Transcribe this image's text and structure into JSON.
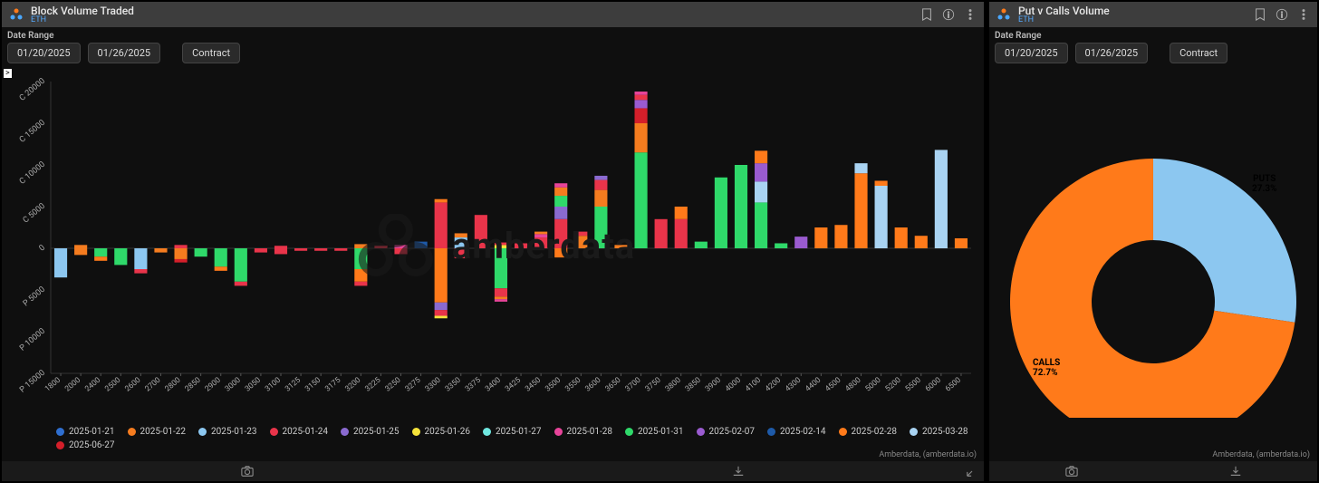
{
  "left": {
    "title": "Block Volume Traded",
    "subtitle": "ETH",
    "date_range_label": "Date Range",
    "date_from": "01/20/2025",
    "date_to": "01/26/2025",
    "contract_btn": "Contract",
    "badge": ">",
    "watermark": "amberdata",
    "attribution": "Amberdata, (amberdata.io)"
  },
  "right": {
    "title": "Put v Calls Volume",
    "subtitle": "ETH",
    "date_range_label": "Date Range",
    "date_from": "01/20/2025",
    "date_to": "01/26/2025",
    "contract_btn": "Contract",
    "attribution": "Amberdata, (amberdata.io)",
    "calls_label": "CALLS",
    "calls_pct": "72.7%",
    "puts_label": "PUTS",
    "puts_pct": "27.3%"
  },
  "colors": {
    "2025-01-21": "#2f6fd0",
    "2025-01-22": "#f57c1f",
    "2025-01-23": "#8cc7f0",
    "2025-01-24": "#e9344a",
    "2025-01-25": "#8a6ad0",
    "2025-01-26": "#f5e33a",
    "2025-01-27": "#6fe7e0",
    "2025-01-28": "#e8449a",
    "2025-01-31": "#2fd96a",
    "2025-02-07": "#9a5bd0",
    "2025-02-14": "#1e5aa8",
    "2025-02-28": "#ff7a1a",
    "2025-03-28": "#a9d3f2",
    "2025-06-27": "#d41f2a"
  },
  "chart_data": [
    {
      "type": "bar",
      "title": "Block Volume Traded",
      "ylabel_calls": "C",
      "ylabel_puts": "P",
      "ylim": [
        -15000,
        20000
      ],
      "y_ticks": [
        20000,
        15000,
        10000,
        5000,
        0,
        -5000,
        -10000,
        -15000
      ],
      "y_tick_labels": [
        "C 20000",
        "C 15000",
        "C 10000",
        "C 5000",
        "0",
        "P 5000",
        "P 10000",
        "P 15000"
      ],
      "categories": [
        "1800",
        "2000",
        "2400",
        "2500",
        "2600",
        "2700",
        "2800",
        "2850",
        "2900",
        "3000",
        "3050",
        "3100",
        "3125",
        "3150",
        "3175",
        "3200",
        "3225",
        "3250",
        "3275",
        "3300",
        "3350",
        "3375",
        "3400",
        "3425",
        "3450",
        "3500",
        "3550",
        "3600",
        "3650",
        "3700",
        "3750",
        "3800",
        "3850",
        "3900",
        "4000",
        "4100",
        "4200",
        "4300",
        "4400",
        "4500",
        "4800",
        "5000",
        "5200",
        "5500",
        "6000",
        "6500"
      ],
      "stacks": {
        "1800": {
          "calls": [],
          "puts": [
            [
              "2025-01-23",
              3500
            ]
          ]
        },
        "2000": {
          "calls": [
            [
              "2025-01-22",
              400
            ]
          ],
          "puts": [
            [
              "2025-01-22",
              800
            ]
          ]
        },
        "2400": {
          "calls": [],
          "puts": [
            [
              "2025-01-31",
              1000
            ],
            [
              "2025-02-28",
              500
            ]
          ]
        },
        "2500": {
          "calls": [],
          "puts": [
            [
              "2025-01-31",
              2000
            ]
          ]
        },
        "2600": {
          "calls": [],
          "puts": [
            [
              "2025-01-23",
              2500
            ],
            [
              "2025-01-24",
              500
            ]
          ]
        },
        "2700": {
          "calls": [],
          "puts": [
            [
              "2025-01-22",
              500
            ]
          ]
        },
        "2800": {
          "calls": [
            [
              "2025-01-24",
              400
            ]
          ],
          "puts": [
            [
              "2025-01-22",
              1300
            ],
            [
              "2025-06-27",
              400
            ]
          ]
        },
        "2850": {
          "calls": [],
          "puts": [
            [
              "2025-01-31",
              1000
            ]
          ]
        },
        "2900": {
          "calls": [],
          "puts": [
            [
              "2025-01-31",
              2200
            ],
            [
              "2025-02-28",
              500
            ]
          ]
        },
        "3000": {
          "calls": [],
          "puts": [
            [
              "2025-01-31",
              4000
            ],
            [
              "2025-01-24",
              500
            ]
          ]
        },
        "3050": {
          "calls": [],
          "puts": [
            [
              "2025-01-24",
              500
            ]
          ]
        },
        "3100": {
          "calls": [
            [
              "2025-01-24",
              300
            ]
          ],
          "puts": [
            [
              "2025-01-24",
              700
            ]
          ]
        },
        "3125": {
          "calls": [],
          "puts": [
            [
              "2025-01-24",
              300
            ]
          ]
        },
        "3150": {
          "calls": [],
          "puts": [
            [
              "2025-01-24",
              300
            ]
          ]
        },
        "3175": {
          "calls": [],
          "puts": [
            [
              "2025-01-24",
              300
            ]
          ]
        },
        "3200": {
          "calls": [
            [
              "2025-01-22",
              500
            ]
          ],
          "puts": [
            [
              "2025-01-31",
              2500
            ],
            [
              "2025-02-28",
              1500
            ],
            [
              "2025-01-24",
              500
            ]
          ]
        },
        "3225": {
          "calls": [
            [
              "2025-01-24",
              300
            ]
          ],
          "puts": []
        },
        "3250": {
          "calls": [
            [
              "2025-01-28",
              400
            ]
          ],
          "puts": [
            [
              "2025-01-24",
              700
            ]
          ]
        },
        "3275": {
          "calls": [
            [
              "2025-02-14",
              800
            ]
          ],
          "puts": []
        },
        "3300": {
          "calls": [
            [
              "2025-01-24",
              5500
            ],
            [
              "2025-02-28",
              400
            ]
          ],
          "puts": [
            [
              "2025-02-28",
              6500
            ],
            [
              "2025-01-25",
              900
            ],
            [
              "2025-01-24",
              700
            ],
            [
              "2025-01-26",
              300
            ]
          ]
        },
        "3350": {
          "calls": [
            [
              "2025-01-23",
              1300
            ],
            [
              "2025-01-22",
              500
            ]
          ],
          "puts": [
            [
              "2025-01-24",
              1200
            ]
          ]
        },
        "3375": {
          "calls": [
            [
              "2025-01-24",
              4000
            ]
          ],
          "puts": []
        },
        "3400": {
          "calls": [
            [
              "2025-01-26",
              400
            ],
            [
              "2025-01-24",
              300
            ]
          ],
          "puts": [
            [
              "2025-01-31",
              4800
            ],
            [
              "2025-01-24",
              1000
            ],
            [
              "2025-01-22",
              300
            ],
            [
              "2025-01-28",
              300
            ]
          ]
        },
        "3425": {
          "calls": [
            [
              "2025-01-24",
              600
            ]
          ],
          "puts": []
        },
        "3450": {
          "calls": [
            [
              "2025-01-24",
              1300
            ],
            [
              "2025-01-28",
              400
            ],
            [
              "2025-01-22",
              300
            ]
          ],
          "puts": []
        },
        "3500": {
          "calls": [
            [
              "2025-01-24",
              3500
            ],
            [
              "2025-01-25",
              1500
            ],
            [
              "2025-01-31",
              1300
            ],
            [
              "2025-01-22",
              1000
            ],
            [
              "2025-01-28",
              500
            ]
          ],
          "puts": [
            [
              "2025-02-28",
              1100
            ]
          ]
        },
        "3550": {
          "calls": [
            [
              "2025-01-22",
              1500
            ],
            [
              "2025-01-24",
              500
            ]
          ],
          "puts": []
        },
        "3600": {
          "calls": [
            [
              "2025-01-31",
              5000
            ],
            [
              "2025-01-22",
              2000
            ],
            [
              "2025-01-24",
              1200
            ],
            [
              "2025-01-25",
              500
            ]
          ],
          "puts": []
        },
        "3650": {
          "calls": [
            [
              "2025-01-22",
              400
            ]
          ],
          "puts": []
        },
        "3700": {
          "calls": [
            [
              "2025-01-31",
              11500
            ],
            [
              "2025-01-22",
              3500
            ],
            [
              "2025-06-27",
              1800
            ],
            [
              "2025-02-07",
              1000
            ],
            [
              "2025-01-24",
              600
            ],
            [
              "2025-01-28",
              400
            ]
          ],
          "puts": []
        },
        "3750": {
          "calls": [
            [
              "2025-01-24",
              3500
            ]
          ],
          "puts": []
        },
        "3800": {
          "calls": [
            [
              "2025-01-24",
              3500
            ],
            [
              "2025-02-28",
              1500
            ]
          ],
          "puts": []
        },
        "3850": {
          "calls": [
            [
              "2025-01-31",
              800
            ]
          ],
          "puts": []
        },
        "3900": {
          "calls": [
            [
              "2025-01-31",
              8500
            ]
          ],
          "puts": []
        },
        "4000": {
          "calls": [
            [
              "2025-01-31",
              10000
            ]
          ],
          "puts": []
        },
        "4100": {
          "calls": [
            [
              "2025-01-31",
              5500
            ],
            [
              "2025-03-28",
              2500
            ],
            [
              "2025-02-07",
              2200
            ],
            [
              "2025-02-28",
              1500
            ]
          ],
          "puts": []
        },
        "4200": {
          "calls": [
            [
              "2025-01-31",
              600
            ]
          ],
          "puts": []
        },
        "4300": {
          "calls": [
            [
              "2025-02-07",
              1400
            ]
          ],
          "puts": []
        },
        "4400": {
          "calls": [
            [
              "2025-02-28",
              2500
            ]
          ],
          "puts": []
        },
        "4500": {
          "calls": [
            [
              "2025-02-28",
              2800
            ]
          ],
          "puts": []
        },
        "4800": {
          "calls": [
            [
              "2025-02-28",
              9000
            ],
            [
              "2025-03-28",
              1200
            ]
          ],
          "puts": []
        },
        "5000": {
          "calls": [
            [
              "2025-03-28",
              7500
            ],
            [
              "2025-02-28",
              600
            ]
          ],
          "puts": []
        },
        "5200": {
          "calls": [
            [
              "2025-02-28",
              2500
            ]
          ],
          "puts": []
        },
        "5500": {
          "calls": [
            [
              "2025-02-28",
              1500
            ]
          ],
          "puts": []
        },
        "6000": {
          "calls": [
            [
              "2025-03-28",
              11800
            ]
          ],
          "puts": []
        },
        "6500": {
          "calls": [
            [
              "2025-02-28",
              1200
            ]
          ],
          "puts": []
        }
      },
      "legend": [
        "2025-01-21",
        "2025-01-22",
        "2025-01-23",
        "2025-01-24",
        "2025-01-25",
        "2025-01-26",
        "2025-01-27",
        "2025-01-28",
        "2025-01-31",
        "2025-02-07",
        "2025-02-14",
        "2025-02-28",
        "2025-03-28",
        "2025-06-27"
      ]
    },
    {
      "type": "pie",
      "title": "Put v Calls Volume",
      "series": [
        {
          "name": "CALLS",
          "value": 72.7
        },
        {
          "name": "PUTS",
          "value": 27.3
        }
      ],
      "colors": {
        "CALLS": "#ff7a1a",
        "PUTS": "#8cc7f0"
      }
    }
  ]
}
